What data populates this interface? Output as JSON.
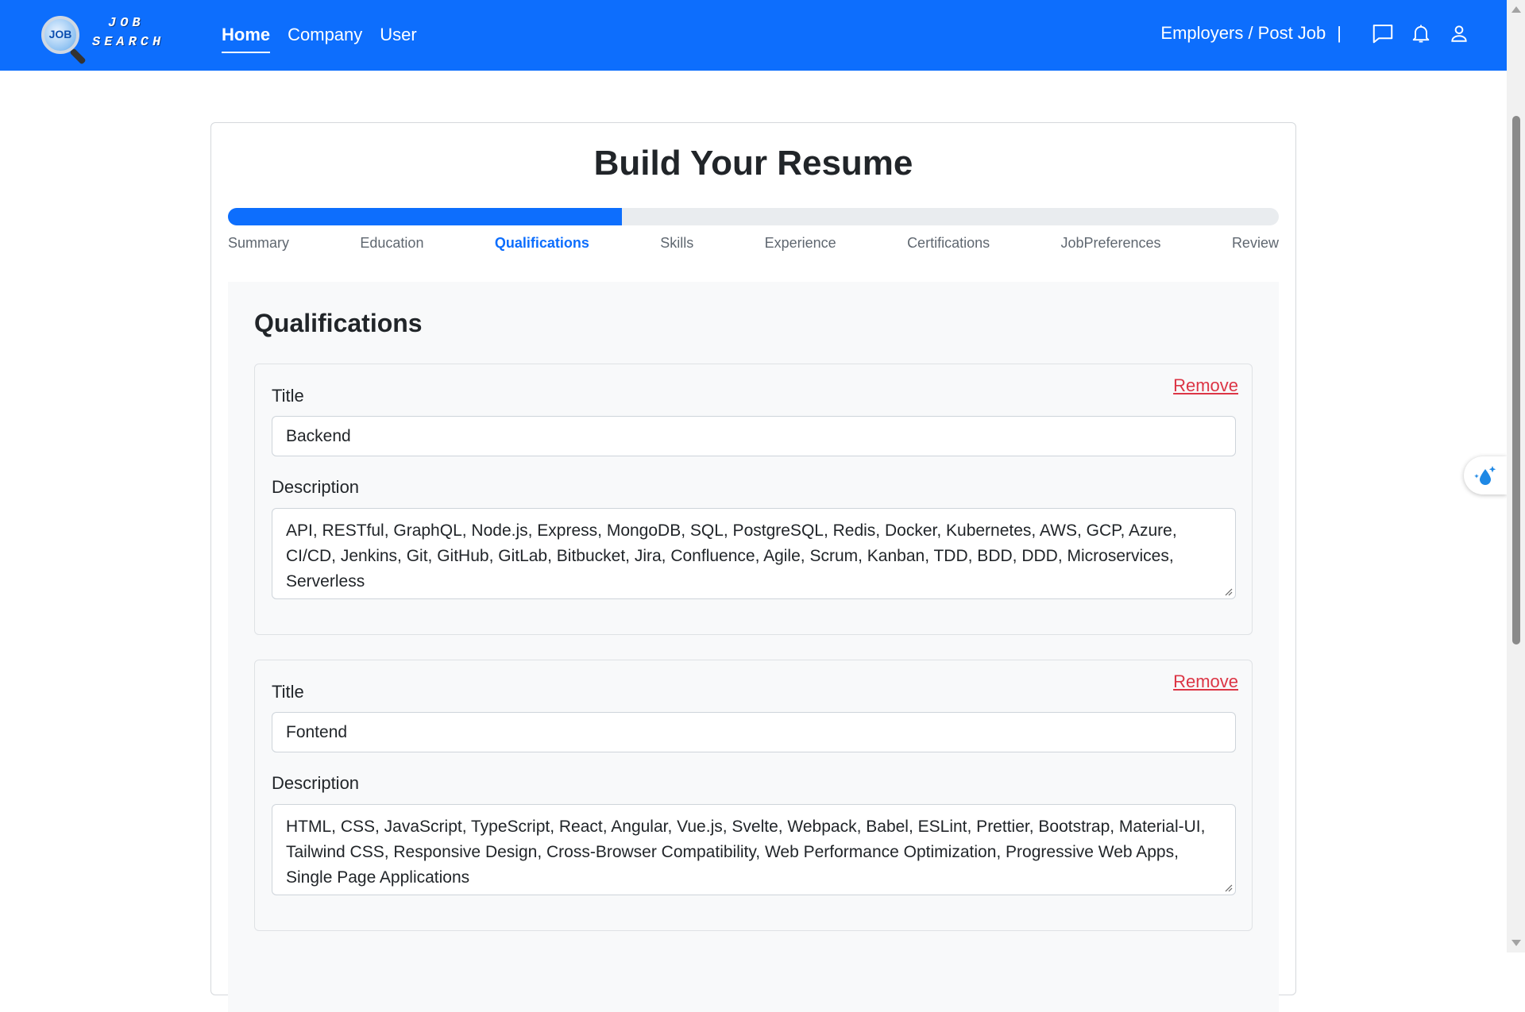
{
  "navbar": {
    "logo": {
      "lens_text": "JOB",
      "word1": "JOB",
      "word2": "SEARCH"
    },
    "links": [
      {
        "label": "Home",
        "active": true
      },
      {
        "label": "Company",
        "active": false
      },
      {
        "label": "User",
        "active": false
      }
    ],
    "employers_label": "Employers / Post Job",
    "separator": "|",
    "icons": [
      "chat-icon",
      "bell-icon",
      "user-icon"
    ],
    "color": "#0d6efd"
  },
  "page": {
    "title": "Build Your Resume",
    "progress_percent": 37.5,
    "steps": [
      {
        "label": "Summary",
        "active": false
      },
      {
        "label": "Education",
        "active": false
      },
      {
        "label": "Qualifications",
        "active": true
      },
      {
        "label": "Skills",
        "active": false
      },
      {
        "label": "Experience",
        "active": false
      },
      {
        "label": "Certifications",
        "active": false
      },
      {
        "label": "JobPreferences",
        "active": false
      },
      {
        "label": "Review",
        "active": false
      }
    ]
  },
  "section": {
    "title": "Qualifications",
    "items": [
      {
        "remove_label": "Remove",
        "title_label": "Title",
        "title_value": "Backend",
        "description_label": "Description",
        "description_value": "API, RESTful, GraphQL, Node.js, Express, MongoDB, SQL, PostgreSQL, Redis, Docker, Kubernetes, AWS, GCP, Azure, CI/CD, Jenkins, Git, GitHub, GitLab, Bitbucket, Jira, Confluence, Agile, Scrum, Kanban, TDD, BDD, DDD, Microservices, Serverless"
      },
      {
        "remove_label": "Remove",
        "title_label": "Title",
        "title_value": "Fontend",
        "description_label": "Description",
        "description_value": "HTML, CSS, JavaScript, TypeScript, React, Angular, Vue.js, Svelte, Webpack, Babel, ESLint, Prettier, Bootstrap, Material-UI, Tailwind CSS, Responsive Design, Cross-Browser Compatibility, Web Performance Optimization, Progressive Web Apps, Single Page Applications"
      }
    ]
  },
  "colors": {
    "primary": "#0d6efd",
    "danger": "#dc3545"
  }
}
